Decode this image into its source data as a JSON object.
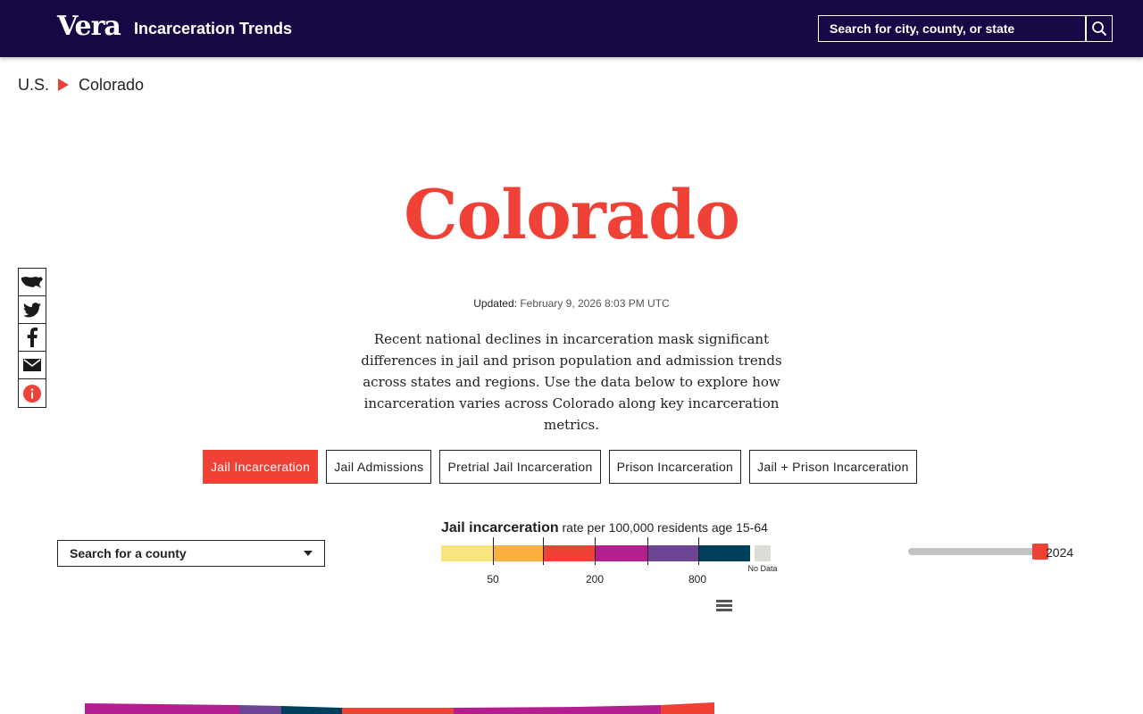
{
  "header": {
    "logo": "Vera",
    "title": "Incarceration Trends",
    "search_placeholder": "Search for city, county, or state"
  },
  "breadcrumb": {
    "items": [
      "U.S.",
      "Colorado"
    ]
  },
  "page": {
    "title": "Colorado",
    "updated_label": "Updated:",
    "updated_value": "February 9, 2026 8:03 PM UTC",
    "intro": "Recent national declines in incarceration mask significant differences in jail and prison population and admission trends across states and regions. Use the data below to explore how incarceration varies across Colorado along key incarceration metrics."
  },
  "share": {
    "icons": [
      "us-map-icon",
      "twitter-icon",
      "facebook-icon",
      "email-icon",
      "info-icon"
    ]
  },
  "tabs": [
    {
      "label": "Jail Incarceration",
      "active": true
    },
    {
      "label": "Jail Admissions",
      "active": false
    },
    {
      "label": "Pretrial Jail Incarceration",
      "active": false
    },
    {
      "label": "Prison Incarceration",
      "active": false
    },
    {
      "label": "Jail + Prison Incarceration",
      "active": false
    }
  ],
  "county_search": {
    "placeholder": "Search for a county"
  },
  "legend": {
    "title_main": "Jail incarceration",
    "title_rest": "rate per 100,000 residents age 15-64",
    "colors": [
      "#f8e57e",
      "#fbb040",
      "#ef4136",
      "#b51e8f",
      "#6b4594",
      "#003f5c"
    ],
    "tick_labels": [
      "50",
      "200",
      "800"
    ],
    "nodata_label": "No Data",
    "nodata_color": "#dcdcd6"
  },
  "year_slider": {
    "min": 1970,
    "max": 2024,
    "value": 2024,
    "label": "2024"
  },
  "accent_color": "#ef4136",
  "header_color": "#150845"
}
